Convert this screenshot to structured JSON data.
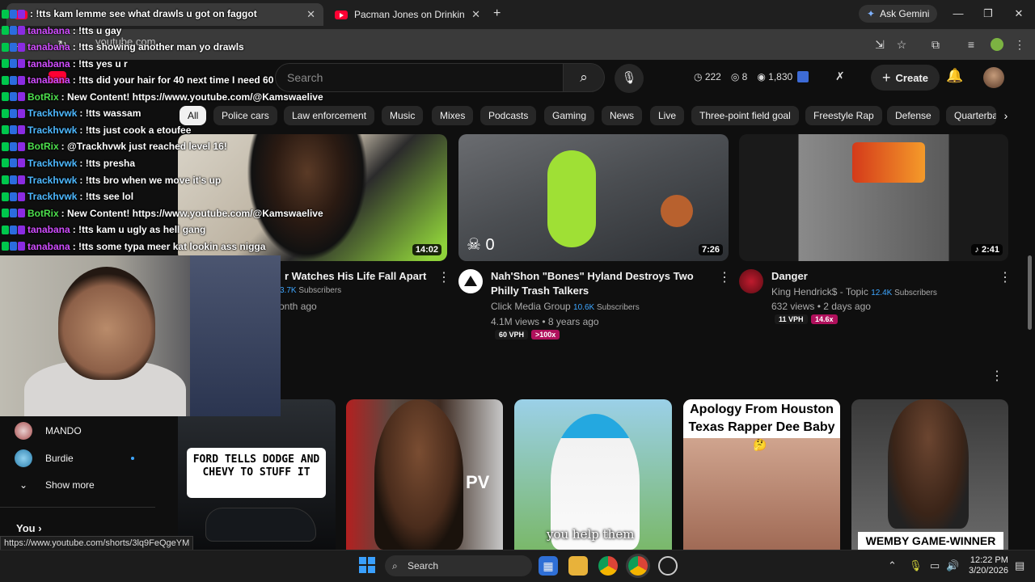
{
  "browser": {
    "tabs": [
      {
        "title": "",
        "active": true
      },
      {
        "title": "Pacman Jones on Drinking THC",
        "active": false
      }
    ],
    "gemini_label": "Ask Gemini",
    "url": "youtube.com"
  },
  "youtube": {
    "search_placeholder": "Search",
    "stats": {
      "a": "222",
      "b": "8",
      "c": "1,830"
    },
    "create_label": "Create",
    "chips": [
      "All",
      "Police cars",
      "Law enforcement",
      "Music",
      "Mixes",
      "Podcasts",
      "Gaming",
      "News",
      "Live",
      "Three-point field goal",
      "Freestyle Rap",
      "Defense",
      "Quarterba"
    ],
    "videos_row1": [
      {
        "title": "r Watches His Life Fall Apart",
        "subs": "3.7K",
        "subs_label": "Subscribers",
        "meta": "onth ago",
        "duration": "14:02"
      },
      {
        "title": "Nah'Shon \"Bones\" Hyland Destroys Two Philly Trash Talkers",
        "channel": "Click Media Group",
        "subs": "10.6K",
        "subs_label": "Subscribers",
        "meta": "4.1M views • 8 years ago",
        "vph": "60 VPH",
        "ratio": ">100x",
        "duration": "7:26",
        "overlay_count": "0"
      },
      {
        "title": "Danger",
        "channel": "King Hendrick$ - Topic",
        "subs": "12.4K",
        "subs_label": "Subscribers",
        "meta": "632 views • 2 days ago",
        "vph": "11 VPH",
        "ratio": "14.6x",
        "duration": "♪ 2:41"
      }
    ],
    "shorts": [
      {
        "caption": "FORD TELLS DODGE AND CHEVY TO STUFF IT"
      },
      {
        "caption": "PV"
      },
      {
        "caption": "you help them"
      },
      {
        "caption": "Apology From Houston Texas Rapper Dee Baby"
      },
      {
        "caption": "WEMBY GAME-WINNER"
      }
    ],
    "sidebar": {
      "subscriptions": [
        "MANDO",
        "Burdie"
      ],
      "show_more": "Show more",
      "you_label": "You"
    },
    "status_url": "https://www.youtube.com/shorts/3lq9FeQgeYM"
  },
  "chat": [
    {
      "user": "",
      "msg": ": !tts kam lemme see what drawls u got on faggot",
      "color": "#d04dff"
    },
    {
      "user": "tanabana",
      "msg": ": !tts u gay",
      "color": "#d04dff"
    },
    {
      "user": "tanabana",
      "msg": ": !tts showing another man yo drawls",
      "color": "#d04dff"
    },
    {
      "user": "tanabana",
      "msg": ": !tts yes u r",
      "color": "#d04dff"
    },
    {
      "user": "tanabana",
      "msg": ": !tts did your hair for 40 next time I need 60",
      "color": "#d04dff"
    },
    {
      "user": "BotRix",
      "msg": ": New Content! https://www.youtube.com/@Kamswaelive",
      "color": "#4ddf4d"
    },
    {
      "user": "Trackhvwk",
      "msg": ": !tts wassam",
      "color": "#4db8ff"
    },
    {
      "user": "Trackhvwk",
      "msg": ": !tts just cook a etoufee",
      "color": "#4db8ff"
    },
    {
      "user": "BotRix",
      "msg": ": @Trackhvwk just reached level 16!",
      "color": "#4ddf4d"
    },
    {
      "user": "Trackhvwk",
      "msg": ": !tts presha",
      "color": "#4db8ff"
    },
    {
      "user": "Trackhvwk",
      "msg": ": !tts bro when we move it's up",
      "color": "#4db8ff"
    },
    {
      "user": "Trackhvwk",
      "msg": ": !tts see lol",
      "color": "#4db8ff"
    },
    {
      "user": "BotRix",
      "msg": ": New Content! https://www.youtube.com/@Kamswaelive",
      "color": "#4ddf4d"
    },
    {
      "user": "tanabana",
      "msg": ": !tts kam u ugly as hell gang",
      "color": "#d04dff"
    },
    {
      "user": "tanabana",
      "msg": ": !tts some typa meer kat lookin ass nigga",
      "color": "#d04dff"
    }
  ],
  "taskbar": {
    "search_label": "Search",
    "time": "12:22 PM",
    "date": "3/20/2026"
  }
}
